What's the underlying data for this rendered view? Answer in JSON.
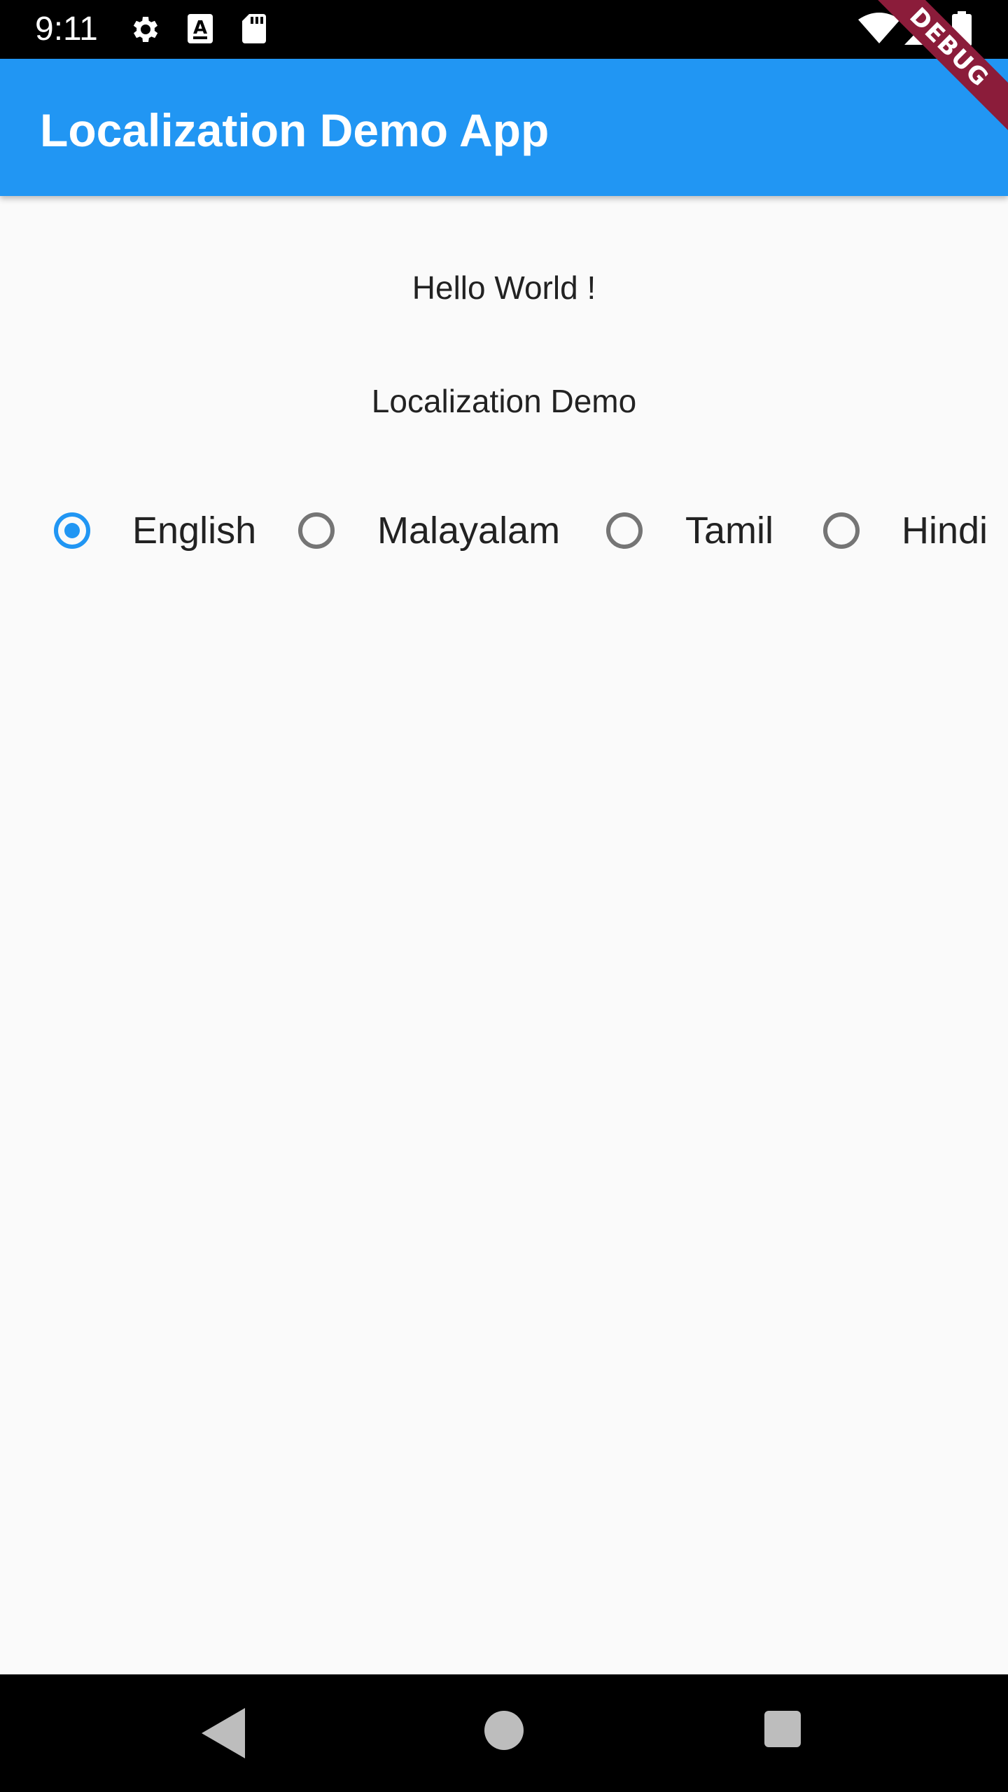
{
  "status_bar": {
    "time": "9:11",
    "icons": [
      "settings-icon",
      "text-a-icon",
      "sd-card-icon",
      "wifi-icon",
      "signal-icon",
      "battery-icon"
    ]
  },
  "app_bar": {
    "title": "Localization Demo App",
    "color": "#2196f3"
  },
  "debug_banner": {
    "label": "DEBUG",
    "color": "#8b1c3a"
  },
  "content": {
    "greeting": "Hello World !",
    "subtitle": "Localization Demo"
  },
  "languages": {
    "selected": "English",
    "options": [
      {
        "label": "English",
        "selected": true
      },
      {
        "label": "Malayalam",
        "selected": false
      },
      {
        "label": "Tamil",
        "selected": false
      },
      {
        "label": "Hindi",
        "selected": false
      }
    ]
  },
  "nav_bar": {
    "buttons": [
      "back-icon",
      "home-icon",
      "recents-icon"
    ]
  }
}
